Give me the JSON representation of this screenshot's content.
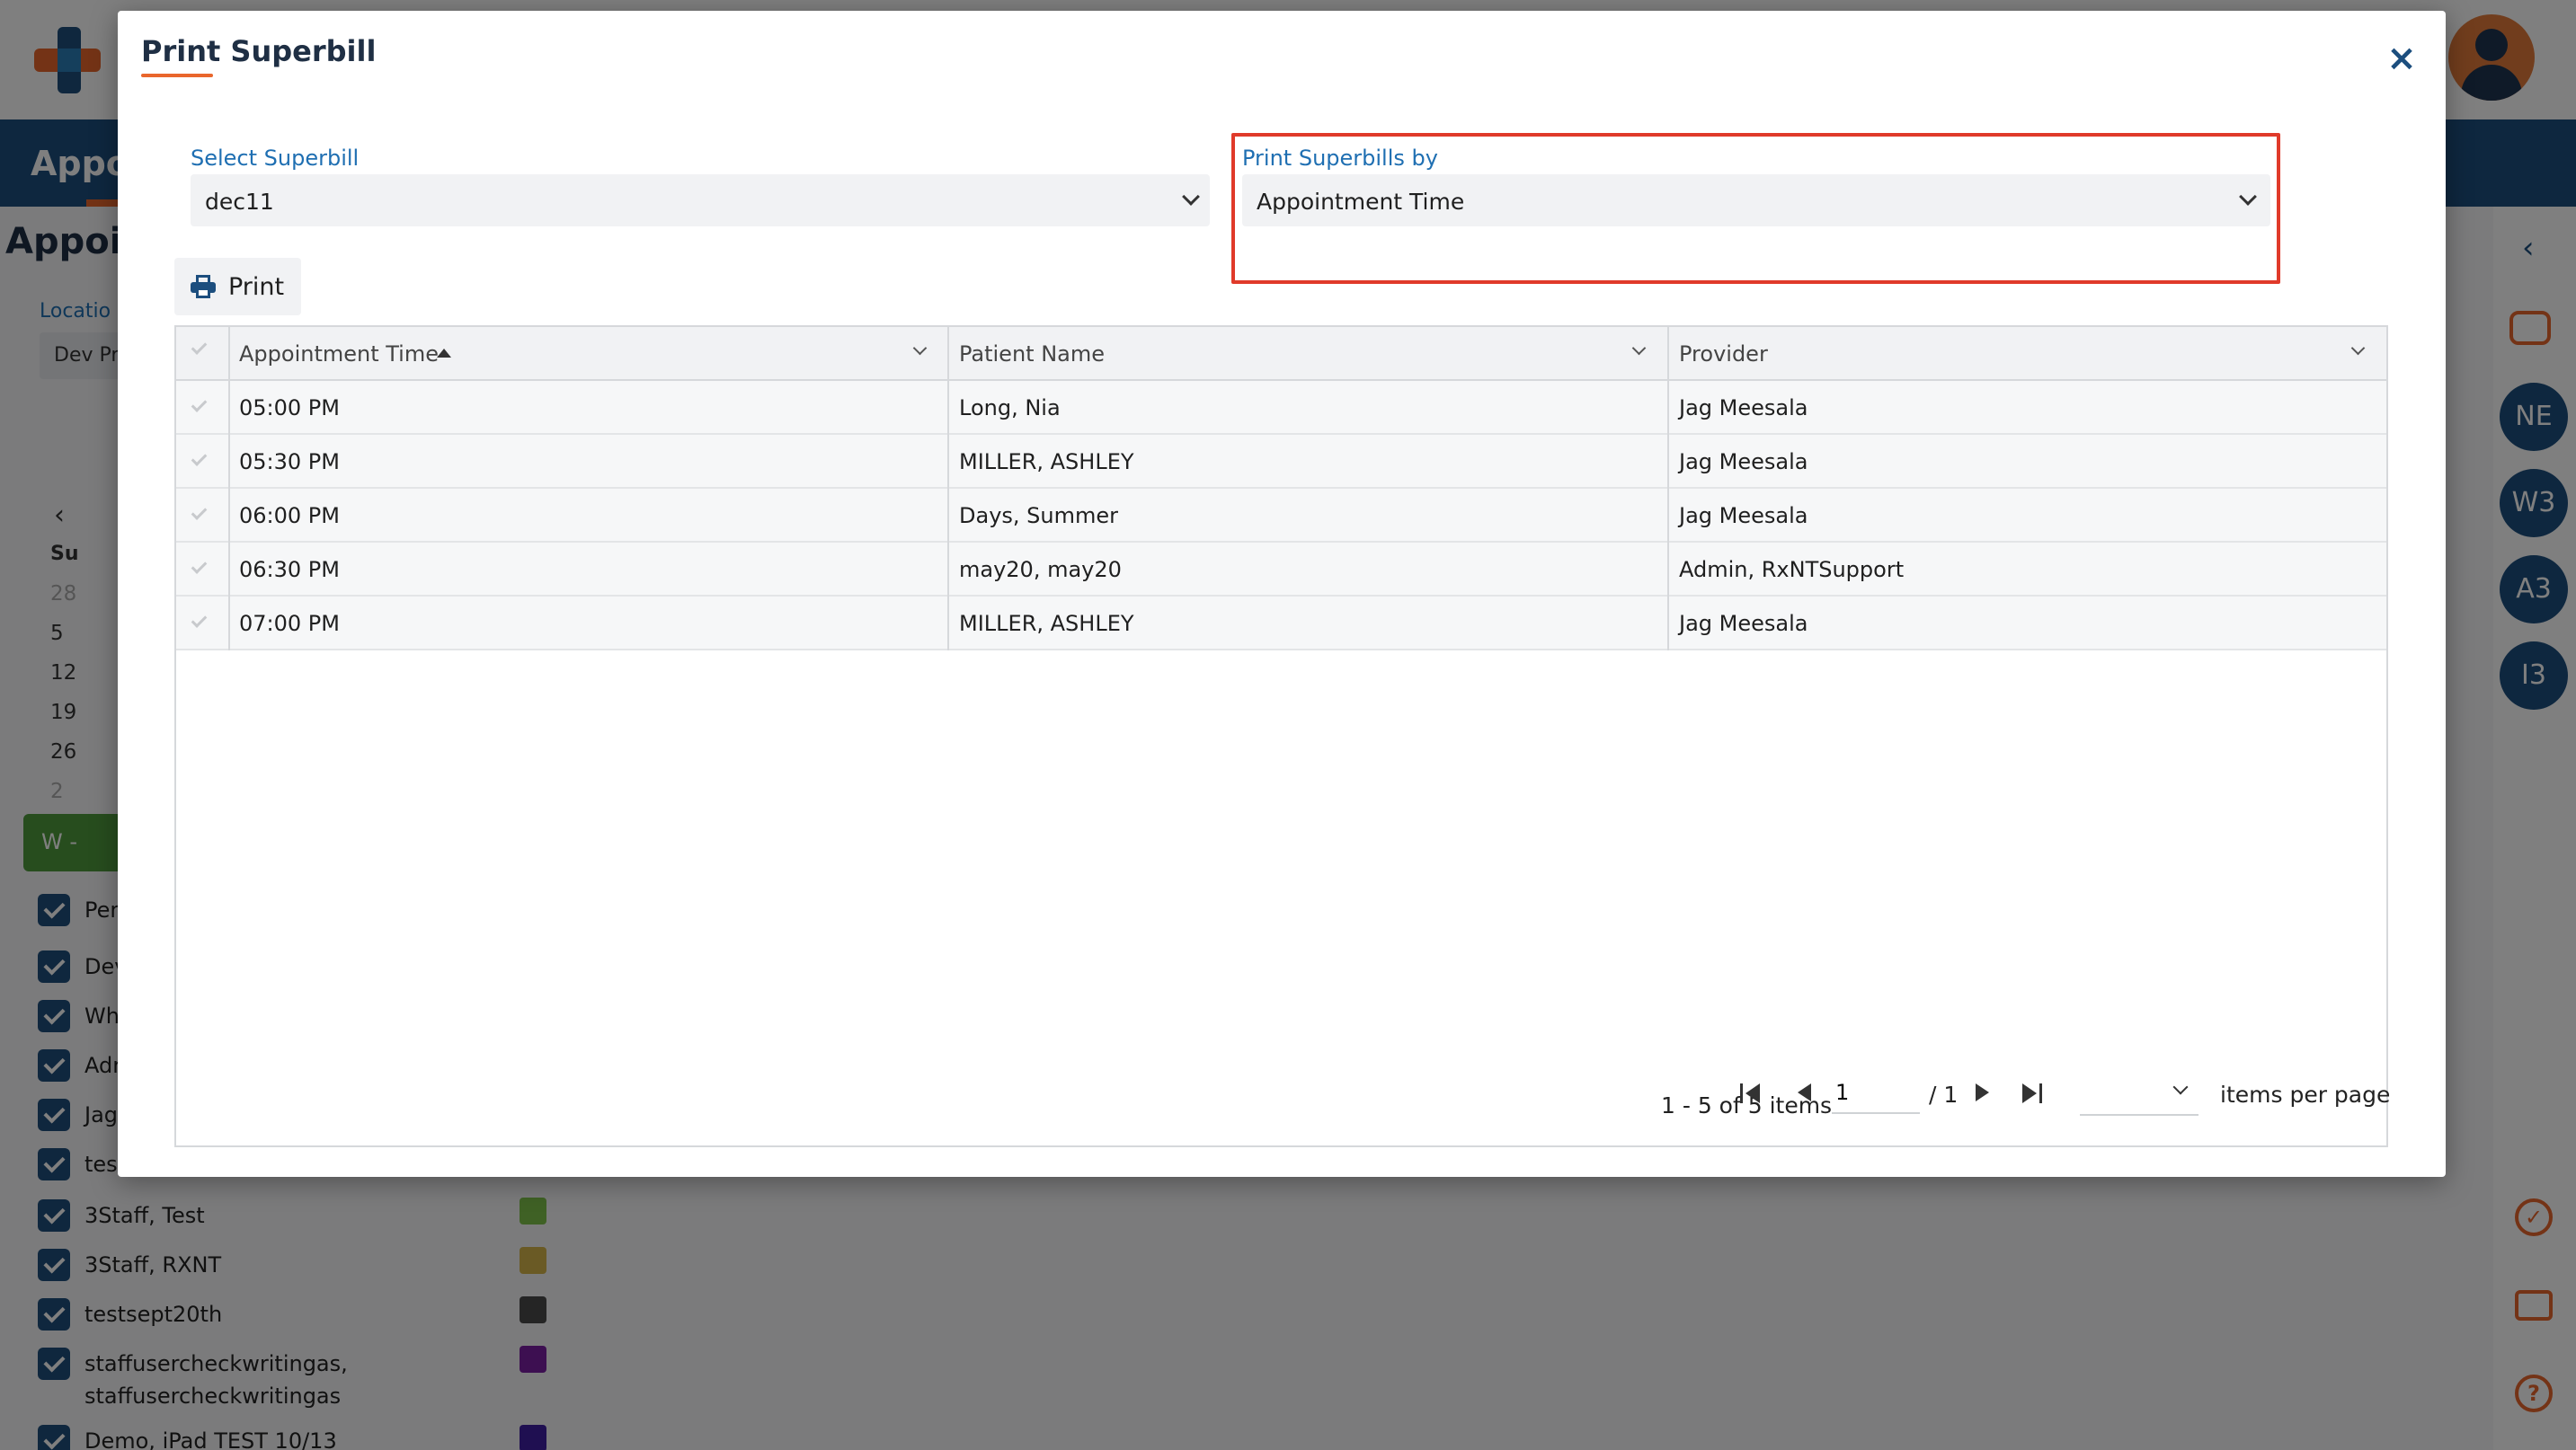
{
  "background": {
    "nav_title": "Appo",
    "page_title": "Appoi",
    "location_label": "Locatio",
    "location_value": "Dev Pr",
    "calendar": {
      "weekday": "Su",
      "days": [
        "28",
        "5",
        "12",
        "19",
        "26",
        "2"
      ]
    },
    "week_button": "W -",
    "staff": [
      {
        "label": "Per",
        "color": ""
      },
      {
        "label": "Dev",
        "color": ""
      },
      {
        "label": "Wh",
        "color": ""
      },
      {
        "label": "Adr",
        "color": ""
      },
      {
        "label": "Jag",
        "color": ""
      },
      {
        "label": "test",
        "color": ""
      },
      {
        "label": "3Staff, Test",
        "color": "#7ec24a"
      },
      {
        "label": "3Staff, RXNT",
        "color": "#d4b44a"
      },
      {
        "label": "testsept20th",
        "color": "#4a4a4a"
      },
      {
        "label": "staffusercheckwritingas, staffusercheckwritingas",
        "color": "#7b1fa2"
      },
      {
        "label": "Demo, iPad TEST 10/13",
        "color": "#3f1fa2"
      }
    ],
    "rail_avatars": [
      "NE",
      "W3",
      "A3",
      "I3"
    ],
    "rail_help": "?",
    "rail_check": "✓"
  },
  "modal": {
    "title": "Print Superbill",
    "close_icon": "×",
    "select_superbill": {
      "label": "Select Superbill",
      "value": "dec11"
    },
    "print_by": {
      "label": "Print Superbills by",
      "value": "Appointment Time"
    },
    "print_button": "Print",
    "grid": {
      "columns": [
        "Appointment Time",
        "Patient Name",
        "Provider"
      ],
      "rows": [
        {
          "time": "05:00 PM",
          "patient": "Long, Nia",
          "provider": "Jag Meesala"
        },
        {
          "time": "05:30 PM",
          "patient": "MILLER, ASHLEY",
          "provider": "Jag Meesala"
        },
        {
          "time": "06:00 PM",
          "patient": "Days, Summer",
          "provider": "Jag Meesala"
        },
        {
          "time": "06:30 PM",
          "patient": "may20, may20",
          "provider": "Admin, RxNTSupport"
        },
        {
          "time": "07:00 PM",
          "patient": "MILLER, ASHLEY",
          "provider": "Jag Meesala"
        }
      ]
    },
    "pager": {
      "info": "1 - 5 of 5 items",
      "page": "1",
      "total": "/ 1",
      "items_per_page": "items per page"
    }
  },
  "colors": {
    "accent": "#e9662c",
    "brand": "#1c4e7e",
    "highlight": "#e03a2a"
  }
}
